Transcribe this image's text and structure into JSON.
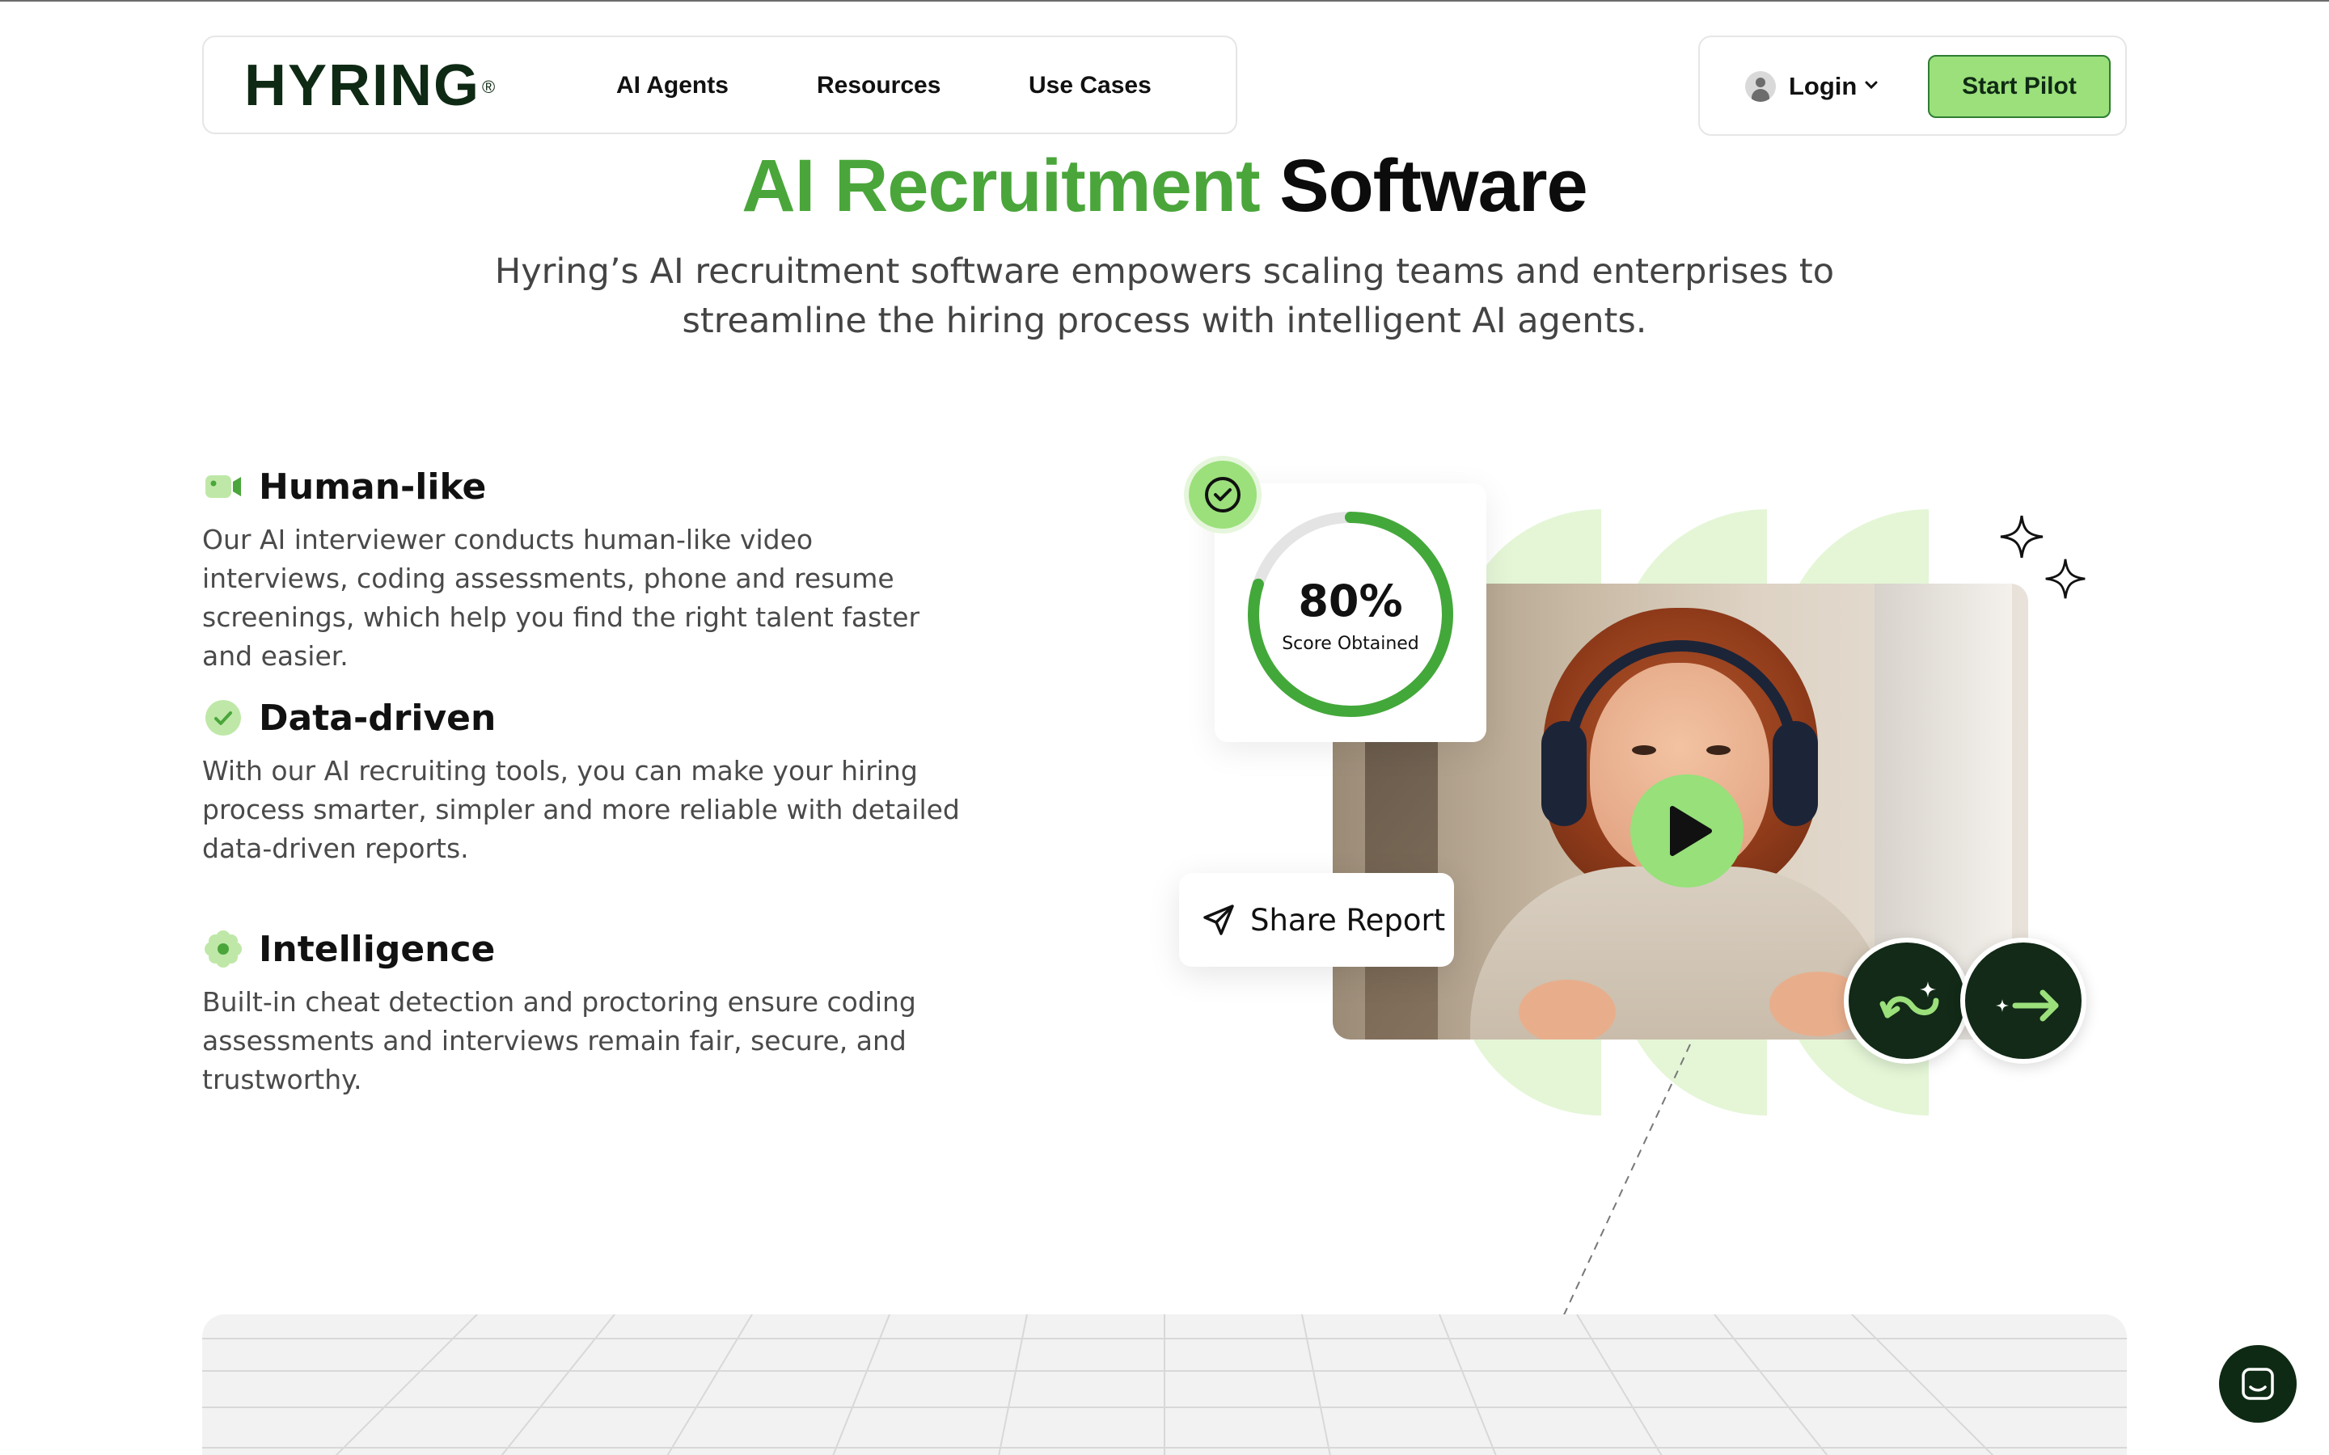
{
  "nav": {
    "brand": "HYRING",
    "brand_mark": "®",
    "links": [
      "AI Agents",
      "Resources",
      "Use Cases"
    ],
    "login_label": "Login",
    "cta_label": "Start Pilot"
  },
  "hero": {
    "title_green": "AI Recruitment",
    "title_dark": "Software",
    "subtitle": "Hyring’s AI recruitment software empowers scaling teams and enterprises to streamline the hiring process with intelligent AI agents."
  },
  "features": [
    {
      "icon": "video-camera-icon",
      "title": "Human-like",
      "text": "Our AI interviewer conducts human-like video interviews, coding assessments, phone and resume screenings, which help you find the right talent faster and easier."
    },
    {
      "icon": "check-circle-icon",
      "title": "Data-driven",
      "text": "With our AI recruiting tools, you can make your hiring process smarter, simpler and more reliable with detailed data-driven reports."
    },
    {
      "icon": "flower-icon",
      "title": "Intelligence",
      "text": "Built-in cheat detection and proctoring ensure coding assessments and interviews remain fair, secure, and trustworthy."
    }
  ],
  "visual": {
    "score_value": "80%",
    "score_label": "Score Obtained",
    "score_fraction": 0.8,
    "share_label": "Share Report"
  },
  "colors": {
    "accent_green": "#4aa63a",
    "light_green": "#9be07b",
    "dark_green": "#0f2a14"
  }
}
